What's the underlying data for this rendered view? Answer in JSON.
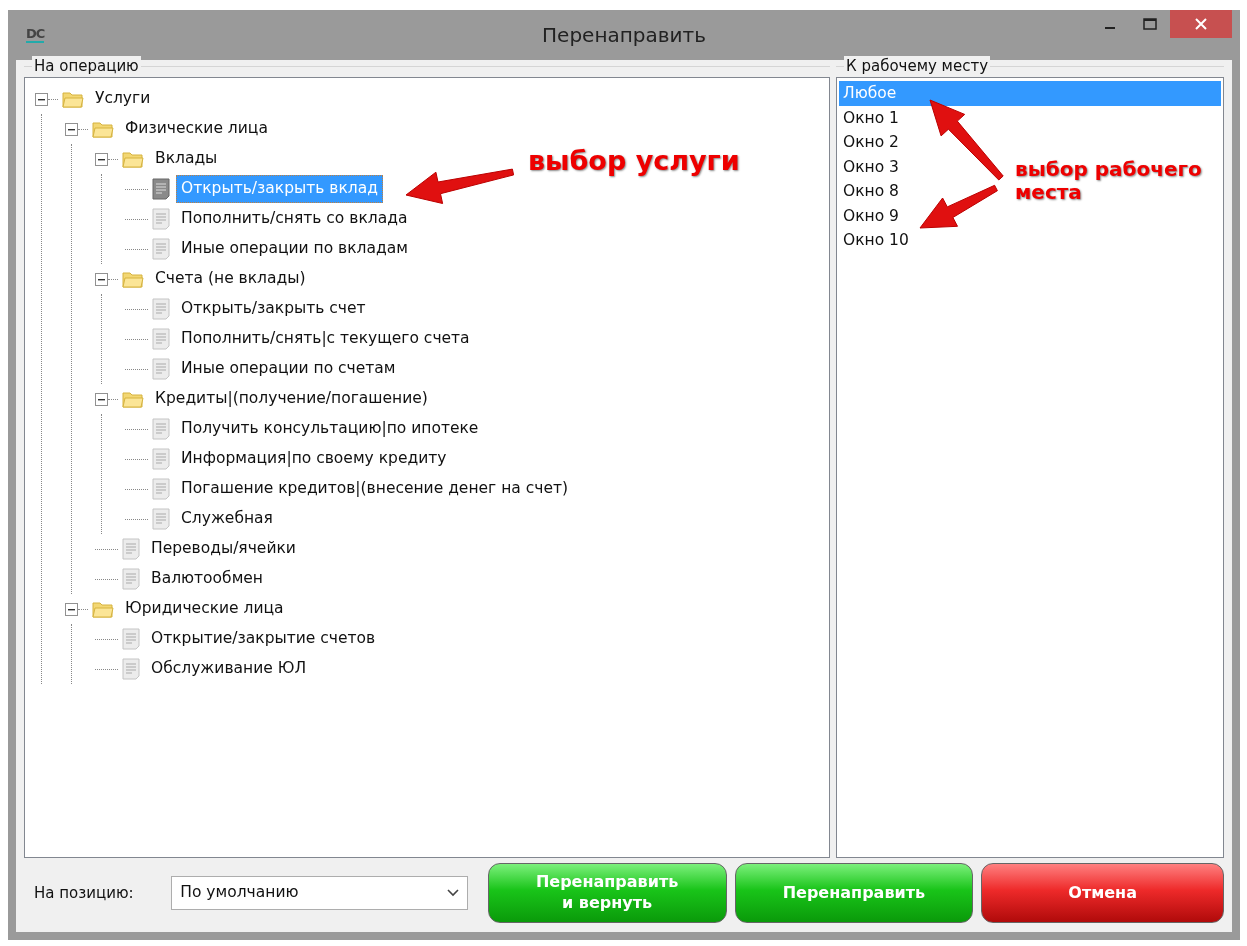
{
  "window": {
    "title": "Перенаправить",
    "logo": "DC"
  },
  "operation_group": {
    "label": "На операцию",
    "tree": [
      {
        "label": "Услуги",
        "kind": "folder",
        "expanded": true,
        "selected": false,
        "children": [
          {
            "label": "Физические лица",
            "kind": "folder",
            "expanded": true,
            "selected": false,
            "children": [
              {
                "label": "Вклады",
                "kind": "folder",
                "expanded": true,
                "selected": false,
                "children": [
                  {
                    "label": "Открыть/закрыть вклад",
                    "kind": "item",
                    "selected": true
                  },
                  {
                    "label": "Пополнить/снять со вклада",
                    "kind": "item",
                    "selected": false
                  },
                  {
                    "label": "Иные операции по вкладам",
                    "kind": "item",
                    "selected": false
                  }
                ]
              },
              {
                "label": "Счета (не вклады)",
                "kind": "folder",
                "expanded": true,
                "selected": false,
                "children": [
                  {
                    "label": "Открыть/закрыть счет",
                    "kind": "item",
                    "selected": false
                  },
                  {
                    "label": "Пополнить/снять|с текущего счета",
                    "kind": "item",
                    "selected": false
                  },
                  {
                    "label": "Иные операции по счетам",
                    "kind": "item",
                    "selected": false
                  }
                ]
              },
              {
                "label": "Кредиты|(получение/погашение)",
                "kind": "folder",
                "expanded": true,
                "selected": false,
                "children": [
                  {
                    "label": "Получить консультацию|по ипотеке",
                    "kind": "item",
                    "selected": false
                  },
                  {
                    "label": "Информация|по своему кредиту",
                    "kind": "item",
                    "selected": false
                  },
                  {
                    "label": "Погашение кредитов|(внесение денег на счет)",
                    "kind": "item",
                    "selected": false
                  },
                  {
                    "label": "Служебная",
                    "kind": "item",
                    "selected": false
                  }
                ]
              },
              {
                "label": "Переводы/ячейки",
                "kind": "item",
                "selected": false
              },
              {
                "label": "Валютообмен",
                "kind": "item",
                "selected": false
              }
            ]
          },
          {
            "label": "Юридические лица",
            "kind": "folder",
            "expanded": true,
            "selected": false,
            "children": [
              {
                "label": "Открытие/закрытие счетов",
                "kind": "item",
                "selected": false
              },
              {
                "label": "Обслуживание ЮЛ",
                "kind": "item",
                "selected": false
              }
            ]
          }
        ]
      }
    ]
  },
  "workplace_group": {
    "label": "К рабочему месту",
    "items": [
      {
        "label": "Любое",
        "selected": true
      },
      {
        "label": "Окно 1",
        "selected": false
      },
      {
        "label": "Окно 2",
        "selected": false
      },
      {
        "label": "Окно 3",
        "selected": false
      },
      {
        "label": "Окно 8",
        "selected": false
      },
      {
        "label": "Окно 9",
        "selected": false
      },
      {
        "label": "Окно 10",
        "selected": false
      }
    ]
  },
  "position": {
    "label": "На позицию:",
    "value": "По умолчанию"
  },
  "buttons": [
    {
      "label": "Перенаправить\nи вернуть",
      "kind": "ok"
    },
    {
      "label": "Перенаправить",
      "kind": "ok"
    },
    {
      "label": "Отмена",
      "kind": "cancel"
    }
  ],
  "annotations": [
    {
      "text": "выбор услуги"
    },
    {
      "text": "выбор рабочего\nместа"
    }
  ]
}
